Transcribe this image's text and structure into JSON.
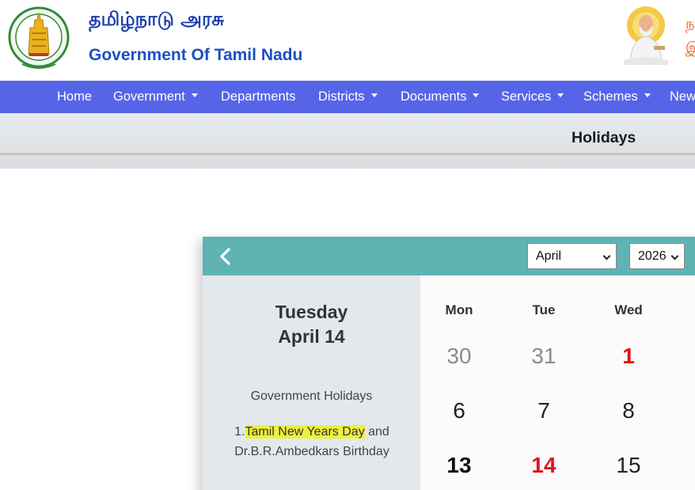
{
  "header": {
    "title_tamil": "தமிழ்நாடு அரசு",
    "title_english": "Government Of Tamil Nadu",
    "side_tamil_1": "ந",
    "side_tamil_2": "இ"
  },
  "nav": {
    "items": [
      {
        "label": "Home",
        "dropdown": false
      },
      {
        "label": "Government",
        "dropdown": true
      },
      {
        "label": "Departments",
        "dropdown": false
      },
      {
        "label": "Districts",
        "dropdown": true
      },
      {
        "label": "Documents",
        "dropdown": true
      },
      {
        "label": "Services",
        "dropdown": true
      },
      {
        "label": "Schemes",
        "dropdown": true
      },
      {
        "label": "New",
        "dropdown": false
      }
    ]
  },
  "page": {
    "title": "Holidays"
  },
  "calendar": {
    "month_select": "April",
    "year_select": "2026",
    "selected_day_name": "Tuesday",
    "selected_date": "April 14",
    "holidays_heading": "Government Holidays",
    "holiday_prefix": "1.",
    "holiday_highlight": "Tamil New Years Day",
    "holiday_rest": " and Dr.B.R.Ambedkars Birthday",
    "weekdays": [
      "Mon",
      "Tue",
      "Wed"
    ],
    "rows": [
      [
        "30",
        "31",
        "1"
      ],
      [
        "6",
        "7",
        "8"
      ],
      [
        "13",
        "14",
        "15"
      ]
    ]
  },
  "colors": {
    "nav_bg": "#5665e8",
    "calendar_header": "#5fb3b3",
    "holiday_red": "#e0141e",
    "highlight": "#eef03a"
  }
}
